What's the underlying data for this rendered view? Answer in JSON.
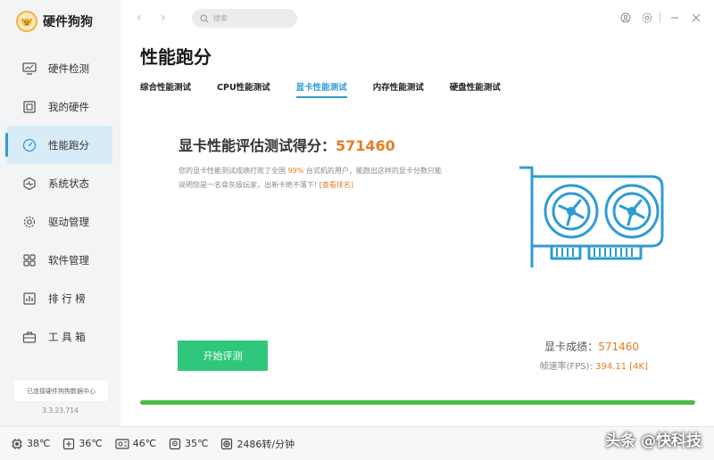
{
  "app": {
    "name": "硬件狗狗",
    "version": "3.3.23.714",
    "datacenter": "已连接硬件狗狗数据中心"
  },
  "sidebar": {
    "items": [
      {
        "label": "硬件检测",
        "icon": "monitor-icon"
      },
      {
        "label": "我的硬件",
        "icon": "board-icon"
      },
      {
        "label": "性能跑分",
        "icon": "gauge-icon",
        "active": true
      },
      {
        "label": "系统状态",
        "icon": "pulse-icon"
      },
      {
        "label": "驱动管理",
        "icon": "gear-icon"
      },
      {
        "label": "软件管理",
        "icon": "apps-icon"
      },
      {
        "label": "排 行 榜",
        "icon": "ranking-icon"
      },
      {
        "label": "工 具 箱",
        "icon": "toolbox-icon"
      }
    ]
  },
  "topbar": {
    "search_placeholder": "搜索"
  },
  "page": {
    "title": "性能跑分"
  },
  "tabs": [
    {
      "label": "综合性能测试"
    },
    {
      "label": "CPU性能测试"
    },
    {
      "label": "显卡性能测试",
      "active": true
    },
    {
      "label": "内存性能测试"
    },
    {
      "label": "硬盘性能测试"
    }
  ],
  "score": {
    "title_prefix": "显卡性能评估测试得分：",
    "value": "571460",
    "desc_part1": "您的显卡性能测试成绩打败了全国",
    "percent": "99%",
    "desc_part2": "台式机的用户，能跑出这样的显卡分数只能说明您是一名骨灰级玩家，出新卡绝不落下!",
    "link": "[查看排名]"
  },
  "actions": {
    "start_label": "开始评测"
  },
  "result": {
    "score_label": "显卡成绩：",
    "score_value": "571460",
    "fps_label": "帧速率(FPS):",
    "fps_value": "394.11 [4K]"
  },
  "progress": {
    "percent": 100,
    "color": "#4dbb45"
  },
  "status": [
    {
      "icon": "cpu-icon",
      "value": "38℃"
    },
    {
      "icon": "gpu-icon",
      "value": "36℃"
    },
    {
      "icon": "motherboard-icon",
      "value": "46℃"
    },
    {
      "icon": "disk-icon",
      "value": "35℃"
    },
    {
      "icon": "fan-icon",
      "value": "2486转/分钟"
    }
  ],
  "watermark": "头条 @快科技",
  "colors": {
    "accent": "#2f9bd4",
    "score": "#e67e22",
    "button": "#2ec77b"
  }
}
